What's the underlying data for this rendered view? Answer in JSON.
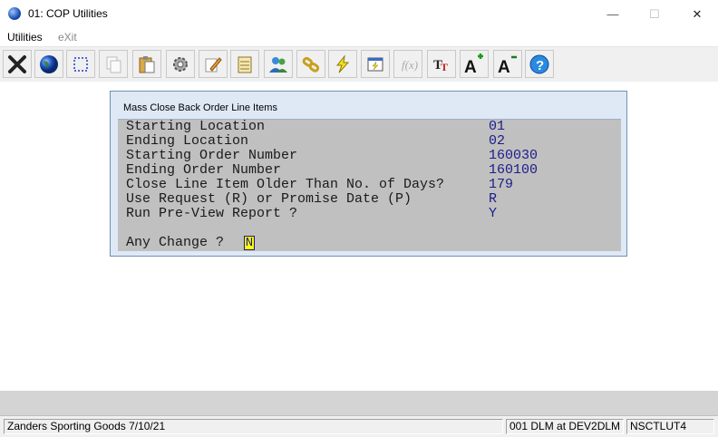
{
  "window": {
    "title": "01: COP Utilities",
    "minimize_glyph": "—",
    "maximize_glyph": "☐",
    "close_glyph": "✕"
  },
  "menubar": {
    "items": [
      {
        "label": "Utilities"
      },
      {
        "label": "eXit"
      }
    ]
  },
  "toolbar": {
    "buttons": [
      {
        "icon": "close-x-icon"
      },
      {
        "icon": "globe-icon"
      },
      {
        "icon": "select-rect-icon"
      },
      {
        "icon": "copy-icon"
      },
      {
        "icon": "paste-icon"
      },
      {
        "icon": "gear-icon"
      },
      {
        "icon": "edit-pencil-icon"
      },
      {
        "icon": "notepad-icon"
      },
      {
        "icon": "users-icon"
      },
      {
        "icon": "chain-link-icon"
      },
      {
        "icon": "lightning-icon"
      },
      {
        "icon": "window-run-icon"
      },
      {
        "icon": "function-icon"
      },
      {
        "icon": "font-tt-icon"
      },
      {
        "icon": "font-increase-icon"
      },
      {
        "icon": "font-decrease-icon"
      },
      {
        "icon": "help-icon"
      }
    ]
  },
  "dialog": {
    "title": "Mass Close Back Order Line Items",
    "fields": [
      {
        "label": "Starting Location",
        "value": "01"
      },
      {
        "label": "Ending Location",
        "value": "02"
      },
      {
        "label": "Starting Order Number",
        "value": "160030"
      },
      {
        "label": "Ending Order Number",
        "value": "160100"
      },
      {
        "label": "Close Line Item Older Than No. of Days?",
        "value": "179"
      },
      {
        "label": "Use Request (R) or Promise Date (P)",
        "value": "R"
      },
      {
        "label": "Run Pre-View Report ?",
        "value": "Y"
      }
    ],
    "prompt": {
      "label": "Any Change ?",
      "value": "N"
    }
  },
  "statusbar": {
    "company": "Zanders Sporting Goods 7/10/21",
    "session": "001 DLM at DEV2DLM",
    "program": "NSCTLUT4"
  },
  "colors": {
    "dialog_bg": "#c0c0c0",
    "value_text": "#1c1c8c",
    "answer_highlight": "#ffff00"
  }
}
